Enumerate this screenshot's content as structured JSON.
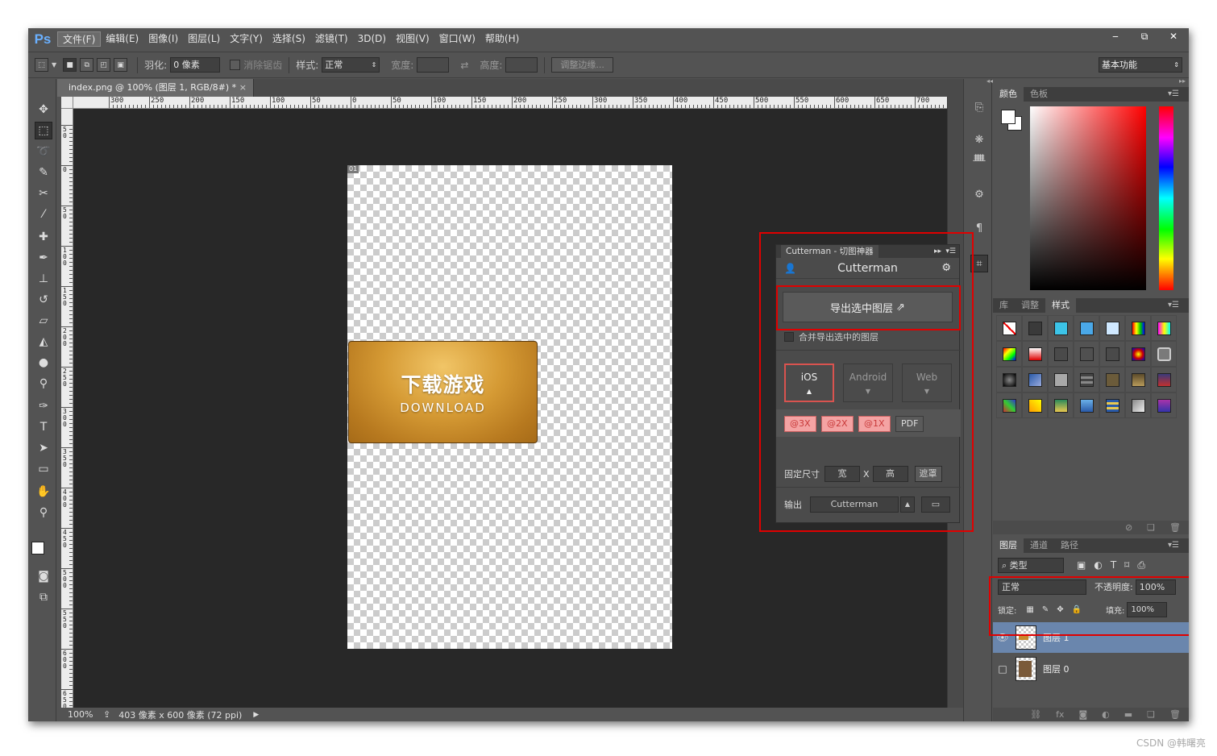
{
  "app": {
    "logo": "Ps"
  },
  "menu": [
    "文件(F)",
    "编辑(E)",
    "图像(I)",
    "图层(L)",
    "文字(Y)",
    "选择(S)",
    "滤镜(T)",
    "3D(D)",
    "视图(V)",
    "窗口(W)",
    "帮助(H)"
  ],
  "window_controls": {
    "minimize": "‒",
    "restore": "⧉",
    "close": "✕"
  },
  "options": {
    "feather_label": "羽化:",
    "feather_value": "0 像素",
    "antialias_label": "消除锯齿",
    "style_label": "样式:",
    "style_value": "正常",
    "width_label": "宽度:",
    "height_label": "高度:",
    "refine_button": "调整边缘...",
    "workspace": "基本功能"
  },
  "document": {
    "tab_title": "index.png @ 100% (图层 1, RGB/8#) *",
    "close": "×",
    "slice_tag": "01",
    "banner_title": "下载游戏",
    "banner_sub": "DOWNLOAD"
  },
  "ruler": {
    "h_labels": [
      "300",
      "250",
      "200",
      "150",
      "100",
      "50",
      "0",
      "50",
      "100",
      "150",
      "200",
      "250",
      "300",
      "350",
      "400",
      "450",
      "500",
      "550",
      "600",
      "650",
      "700"
    ],
    "v_labels": [
      "50",
      "0",
      "50",
      "100",
      "150",
      "200",
      "250",
      "300",
      "350",
      "400",
      "450",
      "500",
      "550",
      "600",
      "650"
    ]
  },
  "status": {
    "zoom": "100%",
    "size": "403 像素 x 600 像素 (72 ppi)"
  },
  "color_panel": {
    "tabs": [
      "颜色",
      "色板"
    ]
  },
  "styles_panel": {
    "tabs": [
      "库",
      "调整",
      "样式"
    ]
  },
  "layers_panel": {
    "tabs": [
      "图层",
      "通道",
      "路径"
    ],
    "filter": "类型",
    "blend": "正常",
    "opacity_label": "不透明度:",
    "opacity_value": "100%",
    "lock_label": "锁定:",
    "fill_label": "填充:",
    "fill_value": "100%",
    "layers": [
      {
        "name": "图层 1",
        "selected": true,
        "visible": true
      },
      {
        "name": "图层 0",
        "selected": false,
        "visible": false
      }
    ]
  },
  "cutterman": {
    "tab": "Cutterman - 切图神器",
    "title": "Cutterman",
    "export_button": "导出选中图层",
    "merge_label": "合并导出选中的图层",
    "platforms": [
      "iOS",
      "Android",
      "Web"
    ],
    "scales": [
      "@3X",
      "@2X",
      "@1X",
      "PDF"
    ],
    "fixed_size_label": "固定尺寸",
    "width_btn": "宽",
    "x_sep": "X",
    "height_btn": "高",
    "mask_btn": "遮罩",
    "output_label": "输出",
    "output_value": "Cutterman"
  },
  "watermark": "CSDN @韩曙亮"
}
